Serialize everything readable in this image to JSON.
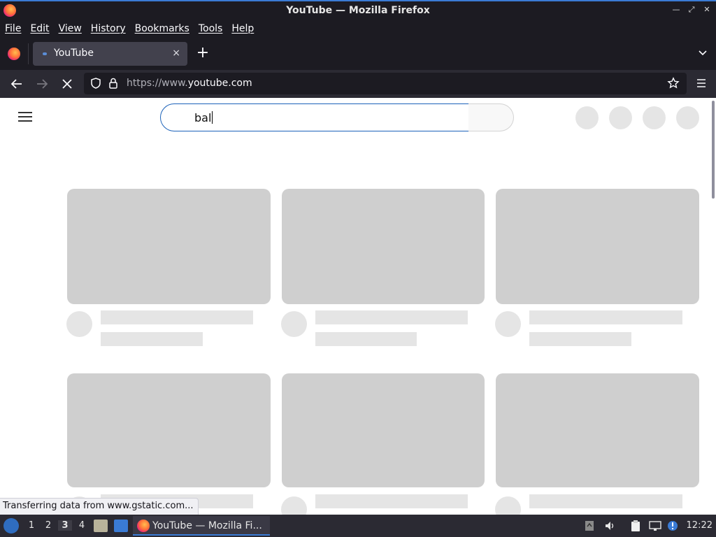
{
  "window": {
    "title": "YouTube — Mozilla Firefox"
  },
  "menubar": {
    "items": [
      "File",
      "Edit",
      "View",
      "History",
      "Bookmarks",
      "Tools",
      "Help"
    ]
  },
  "tabs": [
    {
      "label": "YouTube",
      "close": "×"
    }
  ],
  "newtab": {
    "label": "+"
  },
  "navbar": {
    "url_scheme": "https://www.",
    "url_host": "youtube.com"
  },
  "page": {
    "search_query": "bal"
  },
  "status": {
    "text": "Transferring data from www.gstatic.com..."
  },
  "taskbar": {
    "workspaces": [
      "1",
      "2",
      "3",
      "4"
    ],
    "active_workspace": "3",
    "task_title": "YouTube — Mozilla Fi...",
    "clock": "12:22"
  },
  "colors": {
    "accent": "#3a7bd5",
    "skeleton": "#cfcfcf",
    "skeleton_light": "#e5e5e5"
  }
}
